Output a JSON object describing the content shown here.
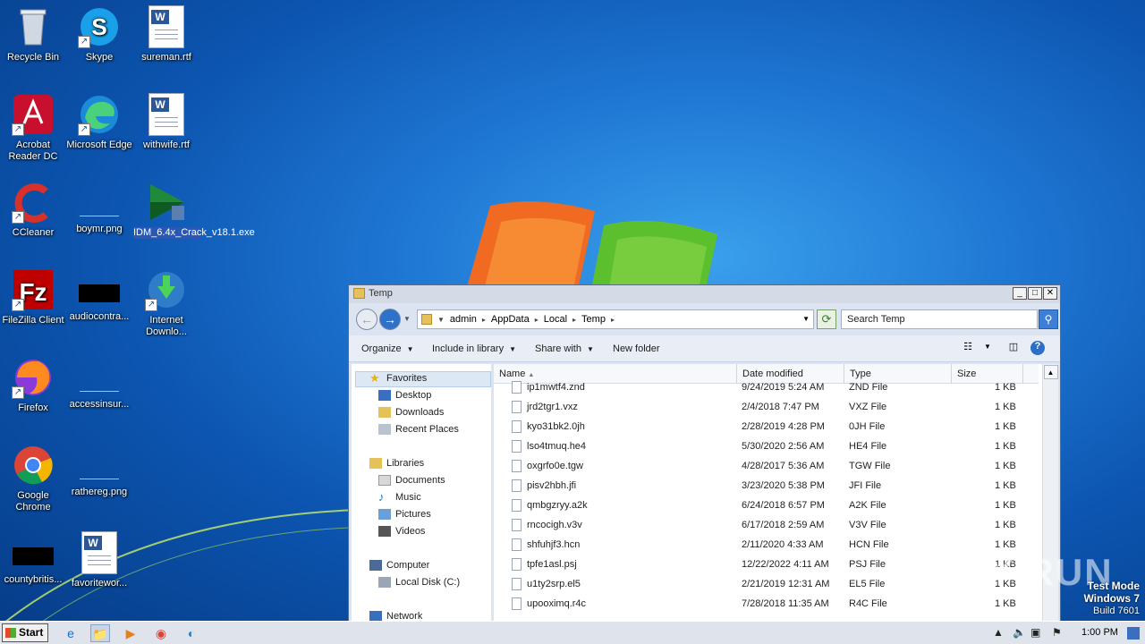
{
  "desktop": {
    "icons": [
      {
        "label": "Recycle Bin"
      },
      {
        "label": "Skype"
      },
      {
        "label": "sureman.rtf"
      },
      {
        "label": "Acrobat Reader DC"
      },
      {
        "label": "Microsoft Edge"
      },
      {
        "label": "withwife.rtf"
      },
      {
        "label": "CCleaner"
      },
      {
        "label": "boymr.png"
      },
      {
        "label": "IDM_6.4x_Crack_v18.1.exe"
      },
      {
        "label": "FileZilla Client"
      },
      {
        "label": "audiocontra..."
      },
      {
        "label": "Internet Downlo..."
      },
      {
        "label": "Firefox"
      },
      {
        "label": "accessinsur..."
      },
      {
        "label": "Google Chrome"
      },
      {
        "label": "rathereg.png"
      },
      {
        "label": "countybritis..."
      },
      {
        "label": "favoritewor..."
      }
    ]
  },
  "window": {
    "title": "Temp",
    "address": [
      "admin",
      "AppData",
      "Local",
      "Temp"
    ],
    "search_placeholder": "Search Temp",
    "toolbar": {
      "organize": "Organize",
      "include": "Include in library",
      "share": "Share with",
      "new_folder": "New folder"
    },
    "nav": {
      "favorites": "Favorites",
      "desktop": "Desktop",
      "downloads": "Downloads",
      "recent": "Recent Places",
      "libraries": "Libraries",
      "documents": "Documents",
      "music": "Music",
      "pictures": "Pictures",
      "videos": "Videos",
      "computer": "Computer",
      "localdisk": "Local Disk (C:)",
      "network": "Network"
    },
    "columns": {
      "name": "Name",
      "date": "Date modified",
      "type": "Type",
      "size": "Size"
    },
    "files": [
      {
        "name": "ip1mwtf4.znd",
        "date": "9/24/2019 5:24 AM",
        "type": "ZND File",
        "size": "1 KB"
      },
      {
        "name": "jrd2tgr1.vxz",
        "date": "2/4/2018 7:47 PM",
        "type": "VXZ File",
        "size": "1 KB"
      },
      {
        "name": "kyo31bk2.0jh",
        "date": "2/28/2019 4:28 PM",
        "type": "0JH File",
        "size": "1 KB"
      },
      {
        "name": "lso4tmuq.he4",
        "date": "5/30/2020 2:56 AM",
        "type": "HE4 File",
        "size": "1 KB"
      },
      {
        "name": "oxgrfo0e.tgw",
        "date": "4/28/2017 5:36 AM",
        "type": "TGW File",
        "size": "1 KB"
      },
      {
        "name": "pisv2hbh.jfi",
        "date": "3/23/2020 5:38 PM",
        "type": "JFI File",
        "size": "1 KB"
      },
      {
        "name": "qmbgzryy.a2k",
        "date": "6/24/2018 6:57 PM",
        "type": "A2K File",
        "size": "1 KB"
      },
      {
        "name": "rncocigh.v3v",
        "date": "6/17/2018 2:59 AM",
        "type": "V3V File",
        "size": "1 KB"
      },
      {
        "name": "shfuhjf3.hcn",
        "date": "2/11/2020 4:33 AM",
        "type": "HCN File",
        "size": "1 KB"
      },
      {
        "name": "tpfe1asl.psj",
        "date": "12/22/2022 4:11 AM",
        "type": "PSJ File",
        "size": "1 KB"
      },
      {
        "name": "u1ty2srp.el5",
        "date": "2/21/2019 12:31 AM",
        "type": "EL5 File",
        "size": "1 KB"
      },
      {
        "name": "upooximq.r4c",
        "date": "7/28/2018 11:35 AM",
        "type": "R4C File",
        "size": "1 KB"
      }
    ]
  },
  "taskbar": {
    "start": "Start",
    "clock": "1:00 PM"
  },
  "overlay": {
    "test_mode": "Test Mode",
    "windows": "Windows 7",
    "build": "Build 7601",
    "watermark": "ANY RUN"
  }
}
